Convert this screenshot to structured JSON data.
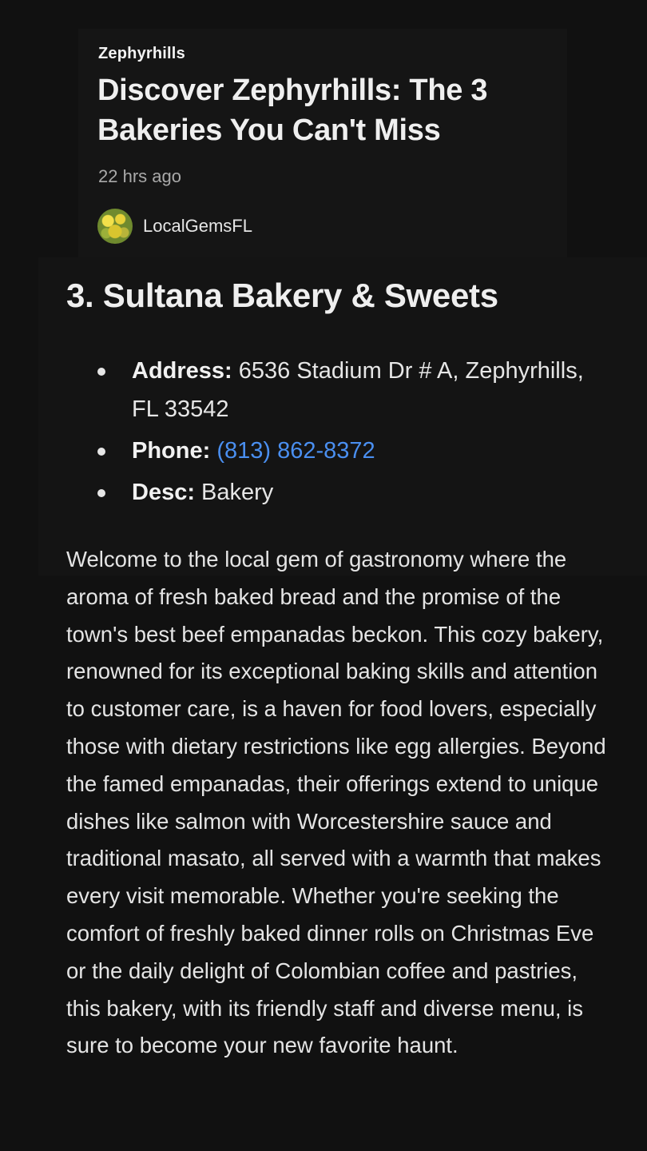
{
  "article": {
    "section": "Zephyrhills",
    "title": "Discover Zephyrhills: The 3 Bakeries You Can't Miss",
    "timestamp": "22 hrs ago",
    "author": "LocalGemsFL"
  },
  "entry": {
    "heading": "3. Sultana Bakery & Sweets",
    "address_label": "Address:",
    "address_value": "6536 Stadium Dr # A, Zephyrhills, FL 33542",
    "phone_label": "Phone:",
    "phone_value": "(813) 862-8372",
    "desc_label": "Desc:",
    "desc_value": "Bakery",
    "description": "Welcome to the local gem of gastronomy where the aroma of fresh baked bread and the promise of the town's best beef empanadas beckon. This cozy bakery, renowned for its exceptional baking skills and attention to customer care, is a haven for food lovers, especially those with dietary restrictions like egg allergies. Beyond the famed empanadas, their offerings extend to unique dishes like salmon with Worcestershire sauce and traditional masato, all served with a warmth that makes every visit memorable. Whether you're seeking the comfort of freshly baked dinner rolls on Christmas Eve or the daily delight of Colombian coffee and pastries, this bakery, with its friendly staff and diverse menu, is sure to become your new favorite haunt."
  },
  "colors": {
    "background": "#111111",
    "link": "#4a8ff0"
  },
  "icons": {
    "avatar": "flower-field-avatar",
    "bullet": "bullet-dot"
  }
}
